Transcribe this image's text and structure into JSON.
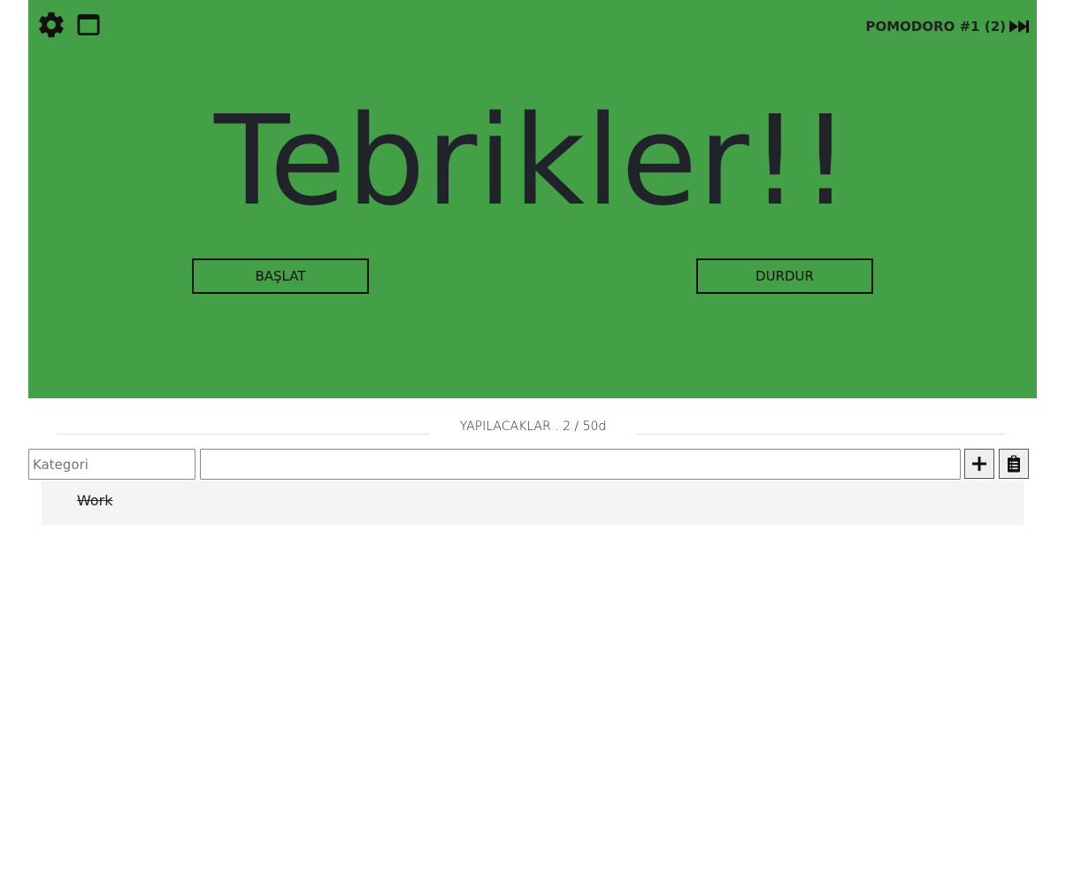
{
  "header": {
    "settings_icon": "gear-icon",
    "window_icon": "window-icon",
    "pomodoro_label": "POMODORO #1 (2)",
    "skip_icon": "fast-forward-icon"
  },
  "timer": {
    "message": "Tebrikler!!",
    "start_label": "BAŞLAT",
    "stop_label": "DURDUR",
    "panel_color": "#43a047"
  },
  "todos": {
    "title": "YAPILACAKLAR . 2 / 50d",
    "category_placeholder": "Kategori",
    "category_value": "",
    "task_value": "",
    "add_icon": "plus-icon",
    "clipboard_icon": "clipboard-list-icon",
    "items": [
      {
        "label": "Work",
        "done": true
      }
    ]
  }
}
